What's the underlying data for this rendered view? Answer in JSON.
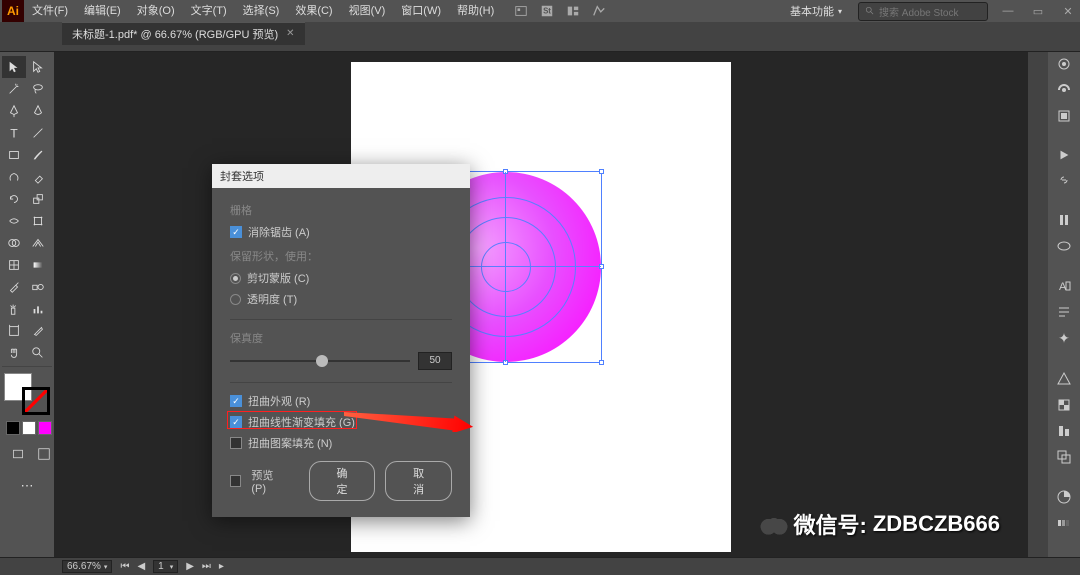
{
  "app": {
    "logo": "Ai"
  },
  "menu": {
    "items": [
      "文件(F)",
      "编辑(E)",
      "对象(O)",
      "文字(T)",
      "选择(S)",
      "效果(C)",
      "视图(V)",
      "窗口(W)",
      "帮助(H)"
    ]
  },
  "workspace_switcher": "基本功能",
  "search": {
    "placeholder": "搜索 Adobe Stock"
  },
  "document": {
    "tab_title": "未标题-1.pdf* @ 66.67% (RGB/GPU 预览)"
  },
  "dialog": {
    "title": "封套选项",
    "raster_section": "栅格",
    "antialias": "消除锯齿 (A)",
    "preserve_shape": "保留形状，使用：",
    "clip_mask": "剪切蒙版 (C)",
    "transparency": "透明度 (T)",
    "fidelity_label": "保真度",
    "fidelity_value": "50",
    "distort_appearance": "扭曲外观 (R)",
    "distort_linear_gradient": "扭曲线性渐变填充 (G)",
    "distort_pattern": "扭曲图案填充 (N)",
    "preview": "预览 (P)",
    "ok": "确定",
    "cancel": "取消"
  },
  "status": {
    "zoom": "66.67%",
    "page": "1",
    "nav_sep": "▸"
  },
  "swatches": {
    "c1": "#000000",
    "c2": "#ffffff",
    "c3": "#ff00ff",
    "c4": "none"
  },
  "watermark": {
    "label": "微信号:",
    "id": "ZDBCZB666"
  }
}
